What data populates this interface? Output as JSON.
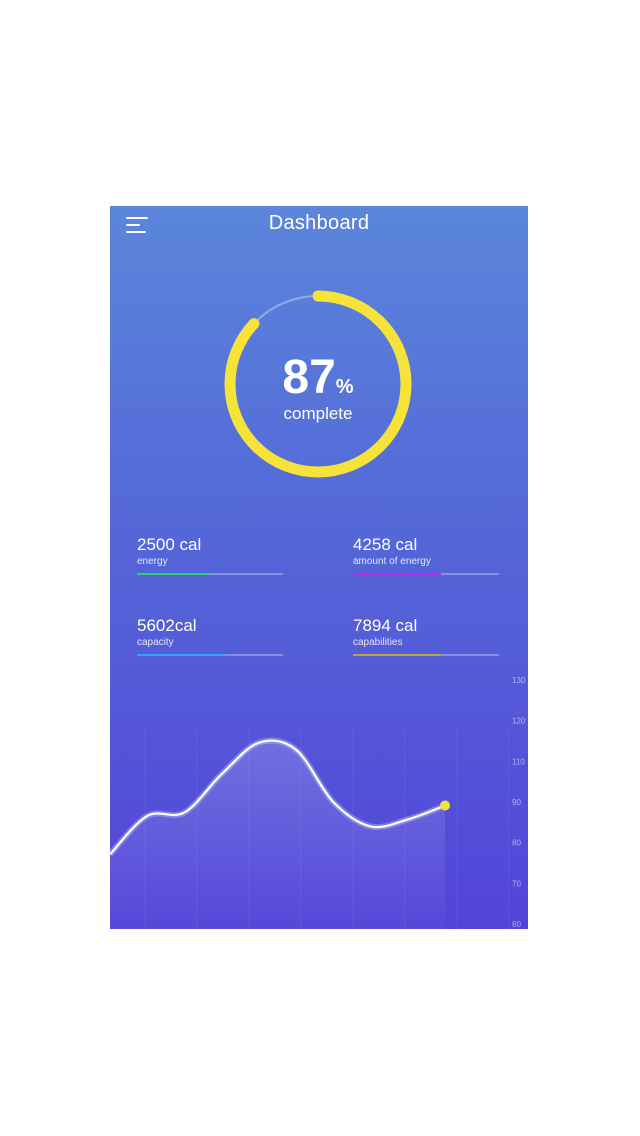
{
  "header": {
    "title": "Dashboard",
    "menu_icon": "hamburger-menu-icon"
  },
  "progress": {
    "value": "87",
    "unit": "%",
    "label": "complete",
    "fraction": 0.87,
    "color": "#f5e33a"
  },
  "stats": [
    {
      "value": "2500 cal",
      "label": "energy",
      "color": "#2fcf78",
      "fill_fraction": 0.5
    },
    {
      "value": "4258 cal",
      "label": "amount of energy",
      "color": "#b52be8",
      "fill_fraction": 0.6
    },
    {
      "value": "5602cal",
      "label": "capacity",
      "color": "#2aa9f0",
      "fill_fraction": 0.6
    },
    {
      "value": "7894 cal",
      "label": "capabilities",
      "color": "#b7a83a",
      "fill_fraction": 0.6
    }
  ],
  "chart_data": {
    "type": "line",
    "ylim": [
      60,
      130
    ],
    "yticks": [
      "130",
      "120",
      "110",
      "90",
      "80",
      "70",
      "60"
    ],
    "series": [
      {
        "values": [
          80,
          91,
          92,
          103,
          112,
          110,
          95,
          88,
          90,
          94
        ]
      }
    ],
    "end_marker_color": "#f5e33a"
  }
}
